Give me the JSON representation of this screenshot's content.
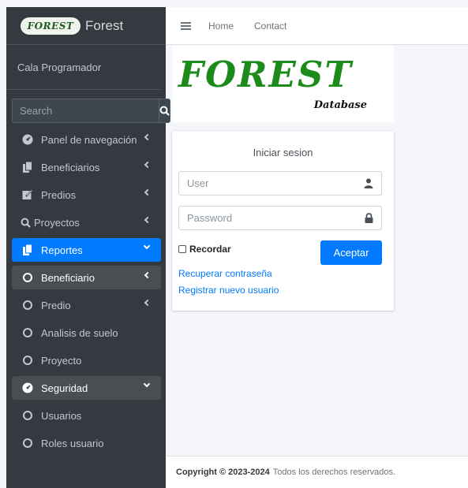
{
  "brand": {
    "logo_text": "FOREST",
    "title": "Forest"
  },
  "user": {
    "name": "Cala Programador"
  },
  "search": {
    "placeholder": "Search"
  },
  "sidebar": {
    "items": [
      {
        "label": "Panel de navegación",
        "icon": "dashboard-icon"
      },
      {
        "label": "Beneficiarios",
        "icon": "copy-icon"
      },
      {
        "label": "Predios",
        "icon": "edit-icon"
      },
      {
        "label": "Proyectos",
        "icon": "search-icon"
      },
      {
        "label": "Reportes",
        "icon": "copy-icon"
      },
      {
        "label": "Beneficiario",
        "icon": "circle-icon"
      },
      {
        "label": "Predio",
        "icon": "circle-icon"
      },
      {
        "label": "Analisis de suelo",
        "icon": "circle-icon"
      },
      {
        "label": "Proyecto",
        "icon": "circle-icon"
      },
      {
        "label": "Seguridad",
        "icon": "dashboard-icon"
      },
      {
        "label": "Usuarios",
        "icon": "circle-icon"
      },
      {
        "label": "Roles usuario",
        "icon": "circle-icon"
      }
    ]
  },
  "topnav": {
    "home": "Home",
    "contact": "Contact"
  },
  "logo": {
    "main": "FOREST",
    "sub": "Database"
  },
  "login": {
    "title": "Iniciar sesion",
    "user_placeholder": "User",
    "password_placeholder": "Password",
    "remember": "Recordar",
    "submit": "Aceptar",
    "recover": "Recuperar contraseña",
    "register": "Registrar nuevo usuario"
  },
  "footer": {
    "copyright": "Copyright © 2023-2024",
    "rights": "Todos los derechos reservados."
  },
  "colors": {
    "sidebar": "#343a40",
    "accent": "#007bff",
    "logo_green": "#1c8b1c"
  }
}
